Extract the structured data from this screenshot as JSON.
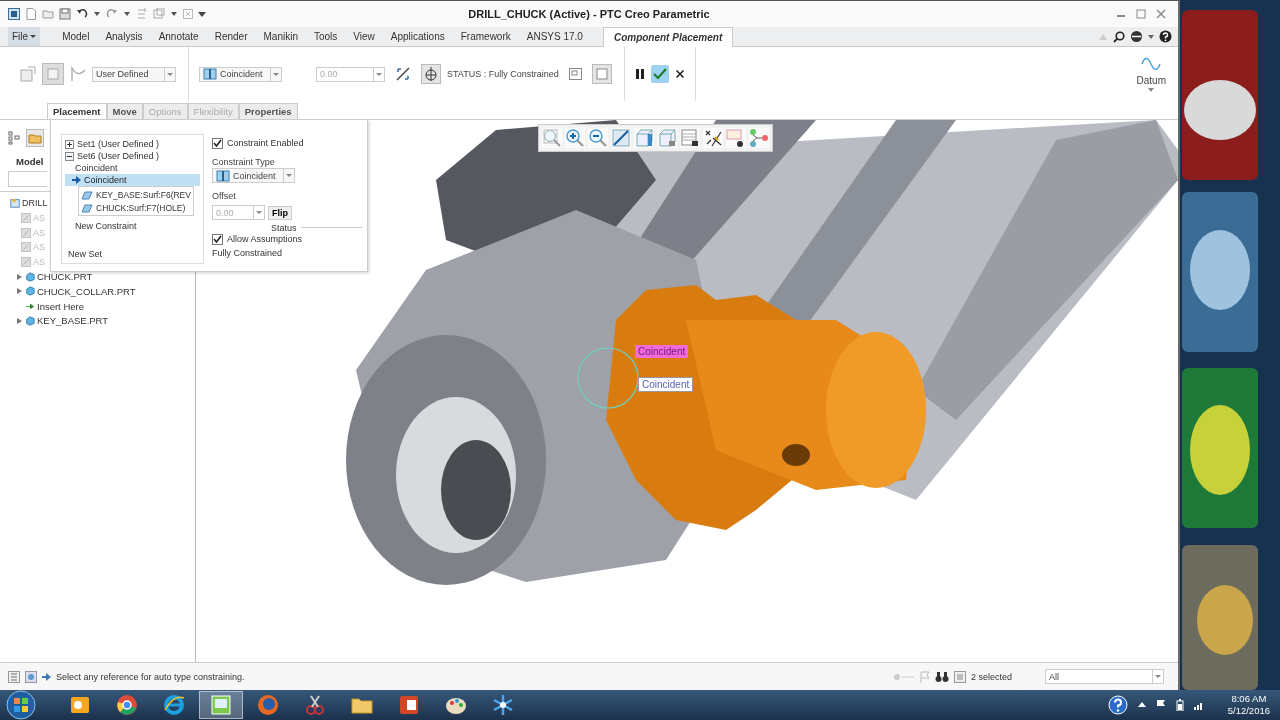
{
  "window": {
    "title": "DRILL_CHUCK (Active) - PTC Creo Parametric"
  },
  "ribbon_tabs": [
    {
      "label": "File",
      "kind": "menu",
      "selected": false
    },
    {
      "label": "Model",
      "kind": "tab",
      "selected": false
    },
    {
      "label": "Analysis",
      "kind": "tab",
      "selected": false
    },
    {
      "label": "Annotate",
      "kind": "tab",
      "selected": false
    },
    {
      "label": "Render",
      "kind": "tab",
      "selected": false
    },
    {
      "label": "Manikin",
      "kind": "tab",
      "selected": false
    },
    {
      "label": "Tools",
      "kind": "tab",
      "selected": false
    },
    {
      "label": "View",
      "kind": "tab",
      "selected": false
    },
    {
      "label": "Applications",
      "kind": "tab",
      "selected": false
    },
    {
      "label": "Framework",
      "kind": "tab",
      "selected": false
    },
    {
      "label": "ANSYS 17.0",
      "kind": "tab",
      "selected": false
    },
    {
      "label": "Component Placement",
      "kind": "tab",
      "selected": true
    }
  ],
  "ribbon": {
    "set_type": "User Defined",
    "constraint_type": "Coincident",
    "offset": {
      "value": "0.00",
      "disabled": true
    },
    "status": "STATUS : Fully Constrained",
    "datum_label": "Datum"
  },
  "dashboard_tabs": [
    {
      "label": "Placement",
      "selected": true,
      "disabled": false
    },
    {
      "label": "Move",
      "selected": false,
      "disabled": false
    },
    {
      "label": "Options",
      "selected": false,
      "disabled": true
    },
    {
      "label": "Flexibility",
      "selected": false,
      "disabled": true
    },
    {
      "label": "Properties",
      "selected": false,
      "disabled": false
    }
  ],
  "model_tree": {
    "header": "Model",
    "items": [
      {
        "label": "DRILL",
        "kind": "assembly",
        "disabled": false
      },
      {
        "label": "AS",
        "kind": "feature",
        "disabled": true
      },
      {
        "label": "AS",
        "kind": "feature",
        "disabled": true
      },
      {
        "label": "AS",
        "kind": "feature",
        "disabled": true
      },
      {
        "label": "AS",
        "kind": "feature",
        "disabled": true
      },
      {
        "label": "CHUCK.PRT",
        "kind": "part",
        "disabled": false
      },
      {
        "label": "CHUCK_COLLAR.PRT",
        "kind": "part",
        "disabled": false
      },
      {
        "label": "Insert Here",
        "kind": "insert",
        "disabled": false
      },
      {
        "label": "KEY_BASE.PRT",
        "kind": "part",
        "disabled": false
      }
    ]
  },
  "placement_panel": {
    "sets": [
      {
        "label": "Set1 (User Defined )",
        "expanded": false
      },
      {
        "label": "Set6 (User Defined )",
        "expanded": true,
        "constraints": [
          {
            "label": "Coincident",
            "selected": false
          },
          {
            "label": "Coincident",
            "selected": true,
            "references": [
              "KEY_BASE:Surf:F6(REV",
              "CHUCK:Surf:F7(HOLE)"
            ]
          }
        ],
        "new_constraint": "New Constraint"
      }
    ],
    "new_set": "New Set",
    "constraint_enabled": {
      "label": "Constraint Enabled",
      "checked": true
    },
    "constraint_type_label": "Constraint Type",
    "constraint_type": "Coincident",
    "offset_label": "Offset",
    "offset": {
      "value": "0.00",
      "disabled": true
    },
    "flip": "Flip",
    "status_heading": "Status",
    "allow_assumptions": {
      "label": "Allow Assumptions",
      "checked": true
    },
    "status": "Fully Constrained"
  },
  "graphics": {
    "callouts": [
      {
        "label": "Coincident",
        "kind": "highlight"
      },
      {
        "label": "Coincident",
        "kind": "plain"
      }
    ]
  },
  "status_bar": {
    "message": "Select any reference for auto type constraining.",
    "selection_count": "2 selected",
    "filter": "All"
  },
  "taskbar": {
    "apps": [
      {
        "kind": "outlook",
        "active": false
      },
      {
        "kind": "chrome",
        "active": false
      },
      {
        "kind": "ie",
        "active": false
      },
      {
        "kind": "creo",
        "active": true
      },
      {
        "kind": "firefox",
        "active": false
      },
      {
        "kind": "snip",
        "active": false
      },
      {
        "kind": "folder",
        "active": false
      },
      {
        "kind": "powerpoint",
        "active": false
      },
      {
        "kind": "paint",
        "active": false
      },
      {
        "kind": "snowflake",
        "active": false
      }
    ],
    "time": "8:06 AM",
    "date": "5/12/2016"
  }
}
